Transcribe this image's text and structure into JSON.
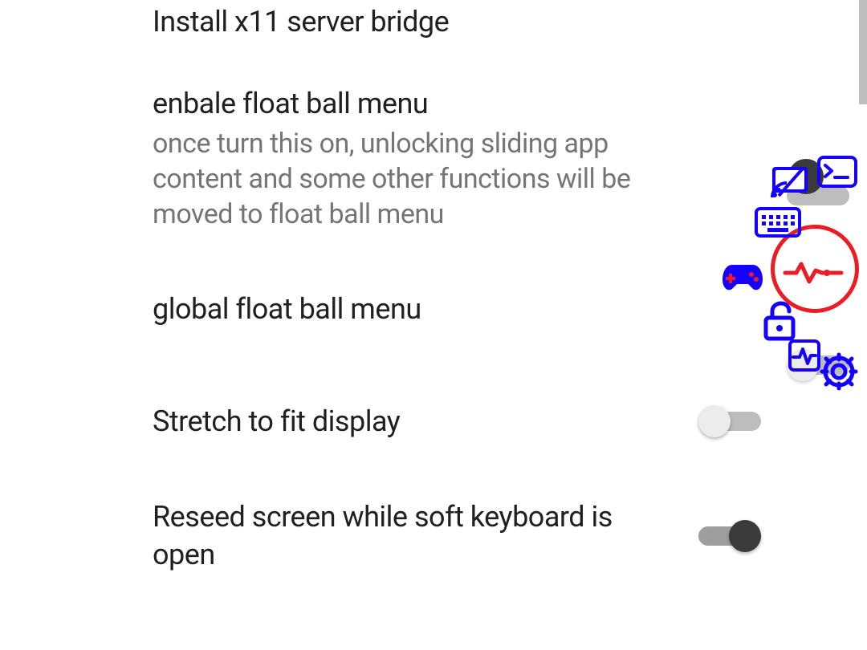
{
  "settings": [
    {
      "key": "install_x11",
      "title": "Install x11 server bridge",
      "subtitle": "",
      "has_switch": false,
      "switch_on": false
    },
    {
      "key": "enable_float_ball",
      "title": "enbale float ball menu",
      "subtitle": "once turn this on, unlocking sliding app content and some other functions will be moved to float ball menu",
      "has_switch": true,
      "switch_on": true
    },
    {
      "key": "global_float_ball",
      "title": "global float ball menu",
      "subtitle": "",
      "has_switch": true,
      "switch_on": false
    },
    {
      "key": "stretch_display",
      "title": "Stretch to fit display",
      "subtitle": "",
      "has_switch": true,
      "switch_on": false
    },
    {
      "key": "reseed_screen",
      "title": "Reseed screen while soft keyboard is open",
      "subtitle": "",
      "has_switch": true,
      "switch_on": true
    }
  ],
  "float_ball_menu": {
    "center_icon": "heartbeat-icon",
    "items_icons": [
      "terminal-icon",
      "cast-icon",
      "keyboard-icon",
      "gamepad-icon",
      "lock-open-icon",
      "activity-monitor-icon",
      "gear-icon"
    ]
  },
  "colors": {
    "icon_blue": "#1500ff",
    "icon_red": "#ec1c24",
    "text_primary": "#202020",
    "text_secondary": "#757575",
    "switch_track": "#bdbdbd",
    "switch_thumb_off": "#ececec",
    "switch_thumb_on": "#3a3a3a"
  }
}
